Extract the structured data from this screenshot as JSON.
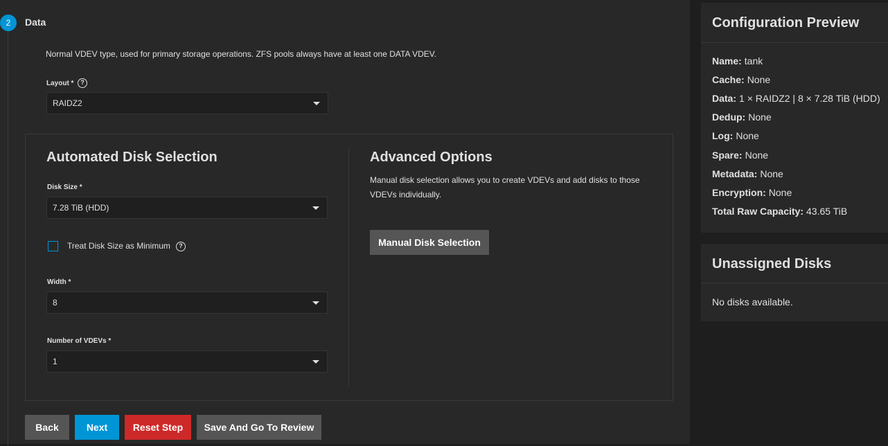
{
  "step": {
    "number": "2",
    "title": "Data",
    "description": "Normal VDEV type, used for primary storage operations. ZFS pools always have at least one DATA VDEV."
  },
  "layout": {
    "label": "Layout *",
    "value": "RAIDZ2"
  },
  "automated": {
    "title": "Automated Disk Selection",
    "disk_size_label": "Disk Size *",
    "disk_size_value": "7.28 TiB (HDD)",
    "treat_min_label": "Treat Disk Size as Minimum",
    "width_label": "Width *",
    "width_value": "8",
    "vdevs_label": "Number of VDEVs *",
    "vdevs_value": "1"
  },
  "advanced": {
    "title": "Advanced Options",
    "text": "Manual disk selection allows you to create VDEVs and add disks to those VDEVs individually.",
    "button": "Manual Disk Selection"
  },
  "buttons": {
    "back": "Back",
    "next": "Next",
    "reset": "Reset Step",
    "review": "Save And Go To Review"
  },
  "preview": {
    "title": "Configuration Preview",
    "rows": [
      {
        "key": "Name:",
        "value": "tank"
      },
      {
        "key": "Cache:",
        "value": "None"
      },
      {
        "key": "Data:",
        "value": "1 × RAIDZ2 | 8 × 7.28 TiB (HDD)"
      },
      {
        "key": "Dedup:",
        "value": "None"
      },
      {
        "key": "Log:",
        "value": "None"
      },
      {
        "key": "Spare:",
        "value": "None"
      },
      {
        "key": "Metadata:",
        "value": "None"
      },
      {
        "key": "Encryption:",
        "value": "None"
      },
      {
        "key": "Total Raw Capacity:",
        "value": "43.65 TiB"
      }
    ]
  },
  "unassigned": {
    "title": "Unassigned Disks",
    "text": "No disks available."
  },
  "colors": {
    "accent": "#0095d5",
    "danger": "#ce2929"
  }
}
